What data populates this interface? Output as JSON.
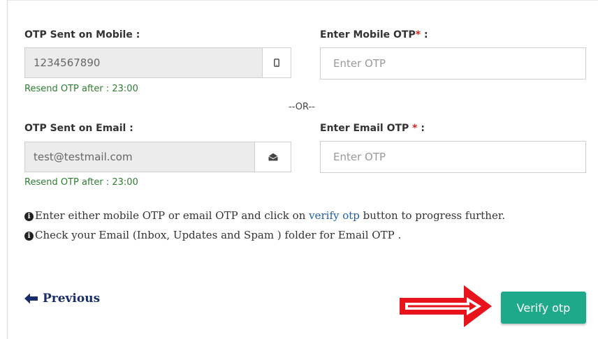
{
  "mobile": {
    "sent_label": "OTP Sent on Mobile :",
    "sent_value": "1234567890",
    "enter_label": "Enter Mobile OTP",
    "required_mark": "*",
    "enter_suffix": " :",
    "placeholder": "Enter OTP",
    "resend": "Resend OTP after : 23:00",
    "icon": "mobile-phone-icon"
  },
  "separator": "--OR--",
  "email": {
    "sent_label": "OTP Sent on Email :",
    "sent_value": "test@testmail.com",
    "enter_label": "Enter Email OTP ",
    "required_mark": "*",
    "enter_suffix": " :",
    "placeholder": "Enter OTP",
    "resend": "Resend OTP after : 23:00",
    "icon": "envelope-open-icon"
  },
  "info": {
    "line1_pre": "Enter either mobile OTP or email OTP and click on ",
    "line1_link": "verify otp",
    "line1_post": " button to progress further.",
    "line2": "Check your Email (Inbox, Updates and Spam ) folder for Email OTP ."
  },
  "buttons": {
    "previous": "Previous",
    "verify": "Verify otp"
  },
  "colors": {
    "verify_bg": "#1eaa8a",
    "resend_text": "#2e7d32",
    "required": "#d9241d",
    "annotation_arrow": "#e8131b",
    "previous_text": "#1a2d6b"
  }
}
